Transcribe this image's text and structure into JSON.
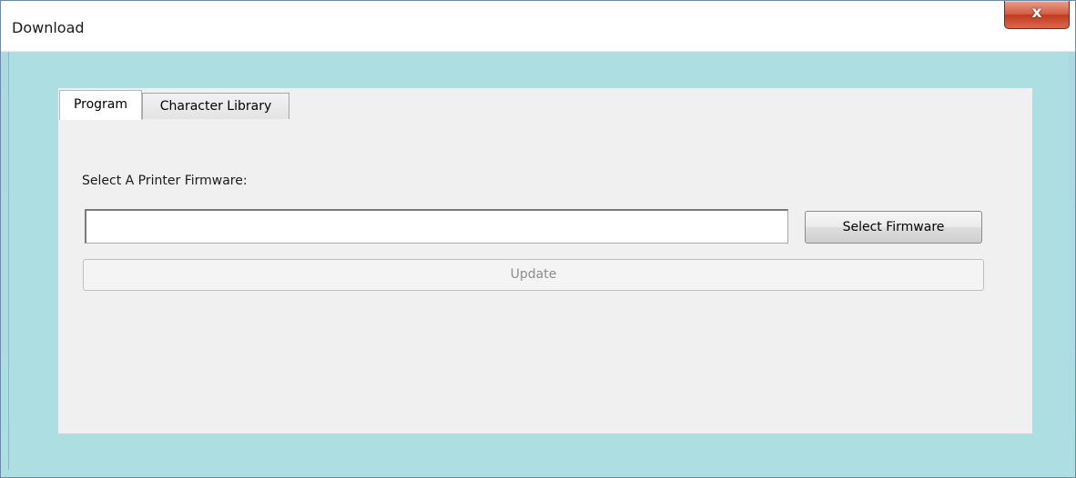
{
  "window": {
    "title": "Download",
    "close_glyph": "x"
  },
  "tabs": [
    {
      "label": "Program",
      "selected": true
    },
    {
      "label": "Character Library",
      "selected": false
    }
  ],
  "program_tab": {
    "firmware_label": "Select A Printer Firmware:",
    "firmware_path_value": "",
    "select_button_label": "Select Firmware",
    "update_button_label": "Update",
    "update_enabled": false
  },
  "icons": {
    "close": "close-icon"
  },
  "colors": {
    "client_background": "#acdee2",
    "panel_background": "#f0f0f0",
    "close_button": "#c84b31",
    "disabled_text": "#8d8d8d"
  }
}
